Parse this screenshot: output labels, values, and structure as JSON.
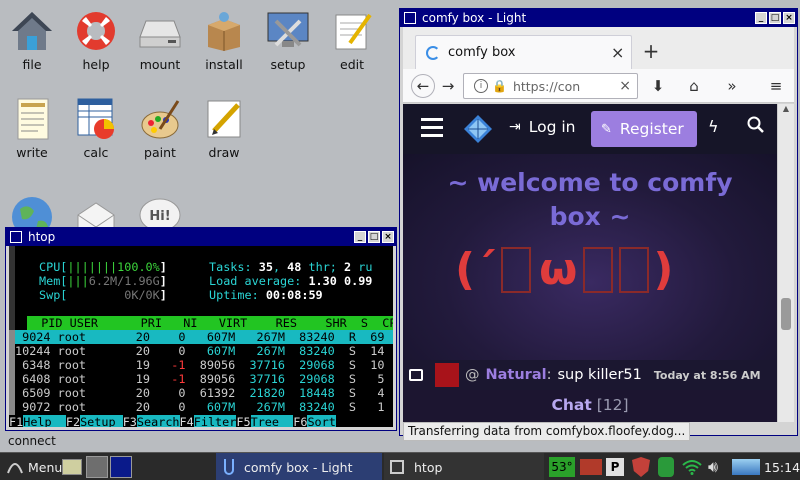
{
  "desktop": {
    "icons": [
      {
        "label": "file"
      },
      {
        "label": "help"
      },
      {
        "label": "mount"
      },
      {
        "label": "install"
      },
      {
        "label": "setup"
      },
      {
        "label": "edit"
      },
      {
        "label": "write"
      },
      {
        "label": "calc"
      },
      {
        "label": "paint"
      },
      {
        "label": "draw"
      }
    ],
    "hi_bubble": "Hi!",
    "partial_label": "connect"
  },
  "htop": {
    "title": "htop",
    "cpu_label": "CPU[",
    "cpu_bars": "|||||||",
    "cpu_value": "100.0%",
    "mem_label": "Mem[",
    "mem_bars": "|||",
    "mem_value": "6.2M/1.96G",
    "swp_label": "Swp[",
    "swp_value": "0K/0K",
    "tasks_label": "Tasks:",
    "tasks_value": "35",
    "thr_value": "48",
    "thr_label": "thr;",
    "running_value": "2",
    "running_label": "ru",
    "load_label": "Load average:",
    "load1": "1.30",
    "load5": "0.99",
    "uptime_label": "Uptime:",
    "uptime_value": "00:08:59",
    "columns": [
      "PID",
      "USER",
      "PRI",
      "NI",
      "VIRT",
      "RES",
      "SHR",
      "S",
      "CP"
    ],
    "rows": [
      {
        "pid": "9024",
        "user": "root",
        "pri": "20",
        "ni": "0",
        "virt": "607M",
        "res": "267M",
        "shr": "83240",
        "s": "R",
        "cpu": "69"
      },
      {
        "pid": "10244",
        "user": "root",
        "pri": "20",
        "ni": "0",
        "virt": "607M",
        "res": "267M",
        "shr": "83240",
        "s": "S",
        "cpu": "14"
      },
      {
        "pid": "6348",
        "user": "root",
        "pri": "19",
        "ni": "-1",
        "virt": "89056",
        "res": "37716",
        "shr": "29068",
        "s": "S",
        "cpu": "10"
      },
      {
        "pid": "6408",
        "user": "root",
        "pri": "19",
        "ni": "-1",
        "virt": "89056",
        "res": "37716",
        "shr": "29068",
        "s": "S",
        "cpu": "5"
      },
      {
        "pid": "6509",
        "user": "root",
        "pri": "20",
        "ni": "0",
        "virt": "61392",
        "res": "21820",
        "shr": "18448",
        "s": "S",
        "cpu": "4"
      },
      {
        "pid": "9072",
        "user": "root",
        "pri": "20",
        "ni": "0",
        "virt": "607M",
        "res": "267M",
        "shr": "83240",
        "s": "S",
        "cpu": "1"
      }
    ],
    "fkeys": [
      {
        "key": "F1",
        "label": "Help"
      },
      {
        "key": "F2",
        "label": "Setup"
      },
      {
        "key": "F3",
        "label": "Search"
      },
      {
        "key": "F4",
        "label": "Filter"
      },
      {
        "key": "F5",
        "label": "Tree"
      },
      {
        "key": "F6",
        "label": "Sort"
      }
    ]
  },
  "firefox": {
    "window_title": "comfy box - Light",
    "tab_title": "comfy box",
    "url": "https://con",
    "site": {
      "login": "Log in",
      "register": "Register",
      "welcome_line1": "~ welcome to comfy",
      "welcome_line2": "box ~",
      "kaomoji_left": "(´",
      "kaomoji_mid": "ω",
      "kaomoji_right": ")",
      "chat_at": "@",
      "chat_user": "Natural",
      "chat_message": "sup killer51",
      "chat_time": "Today at 8:56 AM",
      "chat_title": "Chat",
      "chat_count": "[12]"
    },
    "status": "Transferring data from comfybox.floofey.dog..."
  },
  "taskbar": {
    "menu": "Menu",
    "task_firefox": "comfy box - Light",
    "task_htop": "htop",
    "temp": "53°",
    "clock": "15:14"
  },
  "colors": {
    "titlebar": "#000080",
    "register_bg": "#9c7ee0",
    "welcome_text": "#7a6bd6",
    "kaomoji": "#e03c3c",
    "htop_header": "#22c522",
    "htop_selected": "#18b9c1"
  }
}
